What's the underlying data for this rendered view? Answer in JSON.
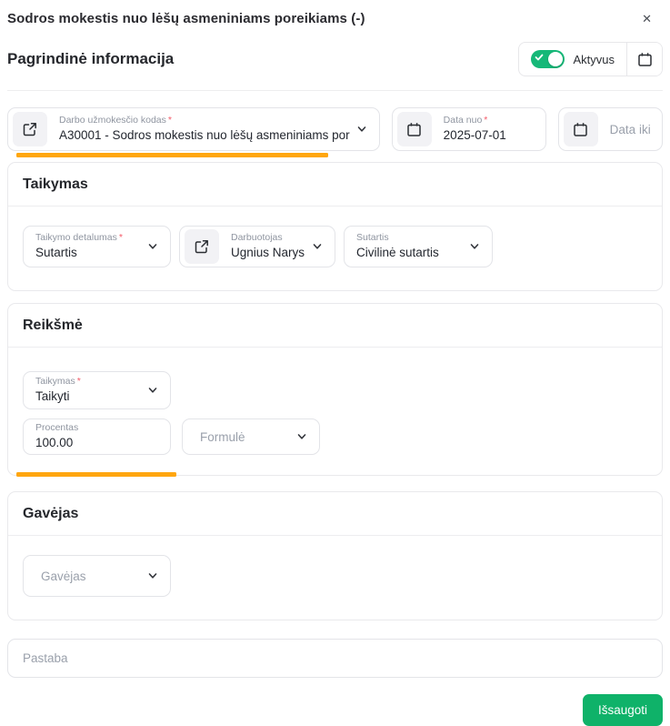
{
  "ui": {
    "required_marker": "*",
    "close_glyph": "✕"
  },
  "colors": {
    "accent_green_toggle": "#16b878",
    "accent_green_button": "#0fb269",
    "highlight_orange": "#ffa60f",
    "border_gray": "#e3e4e8",
    "label_gray": "#8f95a0",
    "text_dark": "#23272f",
    "required_red": "#f45b69"
  },
  "dialog": {
    "title": "Sodros mokestis nuo lėšų asmeniniams poreikiams (-)"
  },
  "main_section": {
    "heading": "Pagrindinė informacija",
    "toggle": {
      "label": "Aktyvus",
      "state": "on"
    }
  },
  "basic": {
    "salary_code": {
      "label": "Darbo užmokesčio kodas",
      "value": "A30001 - Sodros mokestis nuo lėšų asmeniniams por"
    },
    "date_from": {
      "label": "Data nuo",
      "value": "2025-07-01"
    },
    "date_to": {
      "placeholder": "Data iki"
    }
  },
  "taikymas": {
    "heading": "Taikymas",
    "detail": {
      "label": "Taikymo detalumas",
      "value": "Sutartis"
    },
    "employee": {
      "label": "Darbuotojas",
      "value": "Ugnius Narys"
    },
    "contract": {
      "label": "Sutartis",
      "value": "Civilinė sutartis"
    }
  },
  "reiksme": {
    "heading": "Reikšmė",
    "apply": {
      "label": "Taikymas",
      "value": "Taikyti"
    },
    "percent": {
      "label": "Procentas",
      "value": "100.00"
    },
    "formula": {
      "placeholder": "Formulė"
    }
  },
  "gavejas": {
    "heading": "Gavėjas",
    "recipient": {
      "placeholder": "Gavėjas"
    }
  },
  "note": {
    "placeholder": "Pastaba"
  },
  "footer": {
    "save_label": "Išsaugoti"
  }
}
